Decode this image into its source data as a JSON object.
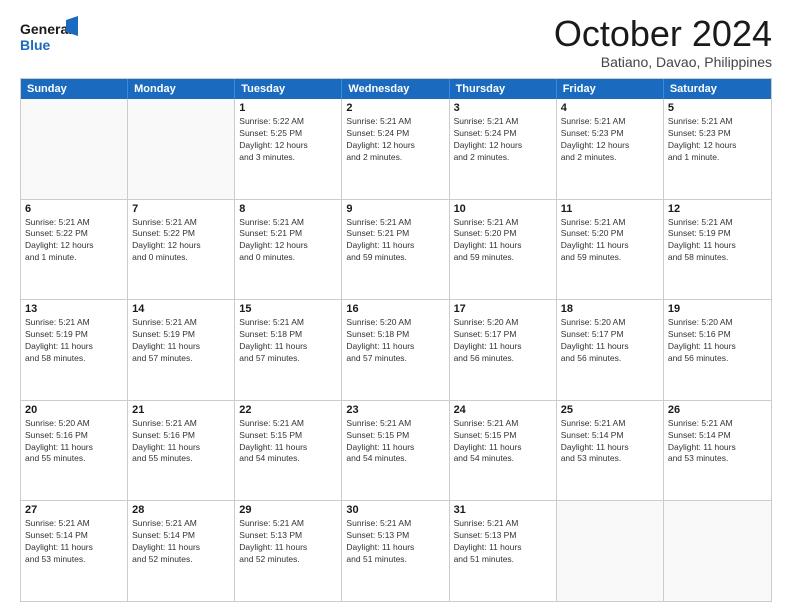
{
  "logo": {
    "line1": "General",
    "line2": "Blue"
  },
  "header": {
    "month": "October 2024",
    "location": "Batiano, Davao, Philippines"
  },
  "weekdays": [
    "Sunday",
    "Monday",
    "Tuesday",
    "Wednesday",
    "Thursday",
    "Friday",
    "Saturday"
  ],
  "weeks": [
    [
      {
        "day": "",
        "info": ""
      },
      {
        "day": "",
        "info": ""
      },
      {
        "day": "1",
        "info": "Sunrise: 5:22 AM\nSunset: 5:25 PM\nDaylight: 12 hours\nand 3 minutes."
      },
      {
        "day": "2",
        "info": "Sunrise: 5:21 AM\nSunset: 5:24 PM\nDaylight: 12 hours\nand 2 minutes."
      },
      {
        "day": "3",
        "info": "Sunrise: 5:21 AM\nSunset: 5:24 PM\nDaylight: 12 hours\nand 2 minutes."
      },
      {
        "day": "4",
        "info": "Sunrise: 5:21 AM\nSunset: 5:23 PM\nDaylight: 12 hours\nand 2 minutes."
      },
      {
        "day": "5",
        "info": "Sunrise: 5:21 AM\nSunset: 5:23 PM\nDaylight: 12 hours\nand 1 minute."
      }
    ],
    [
      {
        "day": "6",
        "info": "Sunrise: 5:21 AM\nSunset: 5:22 PM\nDaylight: 12 hours\nand 1 minute."
      },
      {
        "day": "7",
        "info": "Sunrise: 5:21 AM\nSunset: 5:22 PM\nDaylight: 12 hours\nand 0 minutes."
      },
      {
        "day": "8",
        "info": "Sunrise: 5:21 AM\nSunset: 5:21 PM\nDaylight: 12 hours\nand 0 minutes."
      },
      {
        "day": "9",
        "info": "Sunrise: 5:21 AM\nSunset: 5:21 PM\nDaylight: 11 hours\nand 59 minutes."
      },
      {
        "day": "10",
        "info": "Sunrise: 5:21 AM\nSunset: 5:20 PM\nDaylight: 11 hours\nand 59 minutes."
      },
      {
        "day": "11",
        "info": "Sunrise: 5:21 AM\nSunset: 5:20 PM\nDaylight: 11 hours\nand 59 minutes."
      },
      {
        "day": "12",
        "info": "Sunrise: 5:21 AM\nSunset: 5:19 PM\nDaylight: 11 hours\nand 58 minutes."
      }
    ],
    [
      {
        "day": "13",
        "info": "Sunrise: 5:21 AM\nSunset: 5:19 PM\nDaylight: 11 hours\nand 58 minutes."
      },
      {
        "day": "14",
        "info": "Sunrise: 5:21 AM\nSunset: 5:19 PM\nDaylight: 11 hours\nand 57 minutes."
      },
      {
        "day": "15",
        "info": "Sunrise: 5:21 AM\nSunset: 5:18 PM\nDaylight: 11 hours\nand 57 minutes."
      },
      {
        "day": "16",
        "info": "Sunrise: 5:20 AM\nSunset: 5:18 PM\nDaylight: 11 hours\nand 57 minutes."
      },
      {
        "day": "17",
        "info": "Sunrise: 5:20 AM\nSunset: 5:17 PM\nDaylight: 11 hours\nand 56 minutes."
      },
      {
        "day": "18",
        "info": "Sunrise: 5:20 AM\nSunset: 5:17 PM\nDaylight: 11 hours\nand 56 minutes."
      },
      {
        "day": "19",
        "info": "Sunrise: 5:20 AM\nSunset: 5:16 PM\nDaylight: 11 hours\nand 56 minutes."
      }
    ],
    [
      {
        "day": "20",
        "info": "Sunrise: 5:20 AM\nSunset: 5:16 PM\nDaylight: 11 hours\nand 55 minutes."
      },
      {
        "day": "21",
        "info": "Sunrise: 5:21 AM\nSunset: 5:16 PM\nDaylight: 11 hours\nand 55 minutes."
      },
      {
        "day": "22",
        "info": "Sunrise: 5:21 AM\nSunset: 5:15 PM\nDaylight: 11 hours\nand 54 minutes."
      },
      {
        "day": "23",
        "info": "Sunrise: 5:21 AM\nSunset: 5:15 PM\nDaylight: 11 hours\nand 54 minutes."
      },
      {
        "day": "24",
        "info": "Sunrise: 5:21 AM\nSunset: 5:15 PM\nDaylight: 11 hours\nand 54 minutes."
      },
      {
        "day": "25",
        "info": "Sunrise: 5:21 AM\nSunset: 5:14 PM\nDaylight: 11 hours\nand 53 minutes."
      },
      {
        "day": "26",
        "info": "Sunrise: 5:21 AM\nSunset: 5:14 PM\nDaylight: 11 hours\nand 53 minutes."
      }
    ],
    [
      {
        "day": "27",
        "info": "Sunrise: 5:21 AM\nSunset: 5:14 PM\nDaylight: 11 hours\nand 53 minutes."
      },
      {
        "day": "28",
        "info": "Sunrise: 5:21 AM\nSunset: 5:14 PM\nDaylight: 11 hours\nand 52 minutes."
      },
      {
        "day": "29",
        "info": "Sunrise: 5:21 AM\nSunset: 5:13 PM\nDaylight: 11 hours\nand 52 minutes."
      },
      {
        "day": "30",
        "info": "Sunrise: 5:21 AM\nSunset: 5:13 PM\nDaylight: 11 hours\nand 51 minutes."
      },
      {
        "day": "31",
        "info": "Sunrise: 5:21 AM\nSunset: 5:13 PM\nDaylight: 11 hours\nand 51 minutes."
      },
      {
        "day": "",
        "info": ""
      },
      {
        "day": "",
        "info": ""
      }
    ]
  ]
}
